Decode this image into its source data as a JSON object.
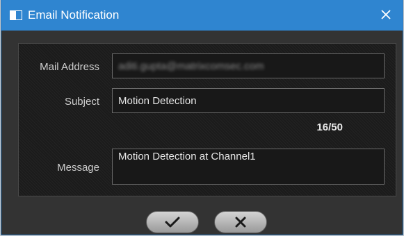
{
  "dialog": {
    "title": "Email Notification",
    "close_glyph": "✕",
    "title_icon": "window-icon"
  },
  "form": {
    "mail_address": {
      "label": "Mail Address",
      "value": "aditi.gupta@matrixcomsec.com"
    },
    "subject": {
      "label": "Subject",
      "value": "Motion Detection",
      "counter": "16/50"
    },
    "message": {
      "label": "Message",
      "value": "Motion Detection at Channel1"
    }
  },
  "buttons": {
    "ok_glyph": "✓",
    "cancel_glyph": "✕"
  },
  "colors": {
    "titlebar": "#2f85d0",
    "panel": "#1b1b1b",
    "text": "#cfcfcf"
  }
}
